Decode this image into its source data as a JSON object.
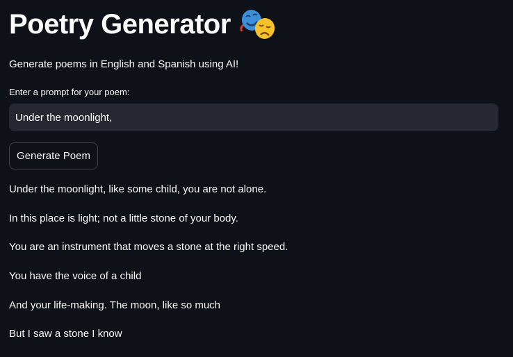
{
  "header": {
    "title": "Poetry Generator",
    "icon": "performing-arts-masks"
  },
  "subtitle": "Generate poems in English and Spanish using AI!",
  "prompt": {
    "label": "Enter a prompt for your poem:",
    "value": "Under the moonlight,"
  },
  "generate_button": "Generate Poem",
  "poem": {
    "lines": [
      "Under the moonlight, like some child, you are not alone.",
      "In this place is light; not a little stone of your body.",
      "You are an instrument that moves a stone at the right speed.",
      "You have the voice of a child",
      "And your life-making. The moon, like so much",
      "But I saw a stone I know"
    ]
  },
  "colors": {
    "background": "#0e1117",
    "input_bg": "#262730",
    "text": "#fafafa"
  }
}
